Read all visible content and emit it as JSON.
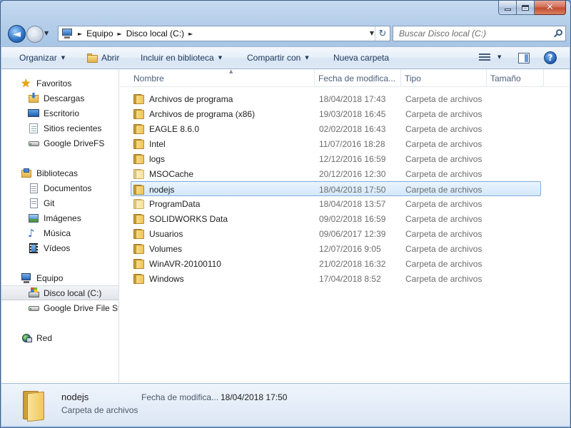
{
  "window": {
    "minimize_glyph": "",
    "close_glyph": "✕"
  },
  "navigation": {
    "back_arrow": "◄",
    "forward_arrow": "►",
    "history_caret": "▼",
    "address": {
      "breadcrumbs": [
        "Equipo",
        "Disco local (C:)"
      ],
      "separator": "►",
      "dropdown_caret": "▼",
      "refresh_glyph": "↻"
    },
    "search": {
      "placeholder": "Buscar Disco local (C:)"
    }
  },
  "toolbar": {
    "organize": "Organizar",
    "open": "Abrir",
    "include_in_library": "Incluir en biblioteca",
    "share_with": "Compartir con",
    "new_folder": "Nueva carpeta",
    "caret": "▼",
    "help": "?"
  },
  "sidebar": {
    "favorites": {
      "label": "Favoritos",
      "items": [
        "Descargas",
        "Escritorio",
        "Sitios recientes",
        "Google DriveFS"
      ]
    },
    "libraries": {
      "label": "Bibliotecas",
      "items": [
        "Documentos",
        "Git",
        "Imágenes",
        "Música",
        "Vídeos"
      ]
    },
    "computer": {
      "label": "Equipo",
      "items": [
        "Disco local (C:)",
        "Google Drive File Str"
      ],
      "selected": "Disco local (C:)"
    },
    "network": {
      "label": "Red"
    },
    "icons": {
      "star": "★",
      "music": "♪"
    }
  },
  "file_list": {
    "columns": {
      "name": "Nombre",
      "date": "Fecha de modifica...",
      "type": "Tipo",
      "size": "Tamaño",
      "sort_caret": "▲"
    },
    "rows": [
      {
        "name": "Archivos de programa",
        "date": "18/04/2018 17:43",
        "type": "Carpeta de archivos"
      },
      {
        "name": "Archivos de programa (x86)",
        "date": "19/03/2018 16:45",
        "type": "Carpeta de archivos"
      },
      {
        "name": "EAGLE 8.6.0",
        "date": "02/02/2018 16:43",
        "type": "Carpeta de archivos"
      },
      {
        "name": "Intel",
        "date": "11/07/2016 18:28",
        "type": "Carpeta de archivos"
      },
      {
        "name": "logs",
        "date": "12/12/2016 16:59",
        "type": "Carpeta de archivos"
      },
      {
        "name": "MSOCache",
        "date": "20/12/2016 12:30",
        "type": "Carpeta de archivos"
      },
      {
        "name": "nodejs",
        "date": "18/04/2018 17:50",
        "type": "Carpeta de archivos"
      },
      {
        "name": "ProgramData",
        "date": "18/04/2018 13:57",
        "type": "Carpeta de archivos"
      },
      {
        "name": "SOLIDWORKS Data",
        "date": "09/02/2018 16:59",
        "type": "Carpeta de archivos"
      },
      {
        "name": "Usuarios",
        "date": "09/06/2017 12:39",
        "type": "Carpeta de archivos"
      },
      {
        "name": "Volumes",
        "date": "12/07/2016 9:05",
        "type": "Carpeta de archivos"
      },
      {
        "name": "WinAVR-20100110",
        "date": "21/02/2018 16:32",
        "type": "Carpeta de archivos"
      },
      {
        "name": "Windows",
        "date": "17/04/2018 8:52",
        "type": "Carpeta de archivos"
      }
    ],
    "selected": "nodejs"
  },
  "details_pane": {
    "name": "nodejs",
    "type": "Carpeta de archivos",
    "date_label": "Fecha de modifica...",
    "date_value": "18/04/2018 17:50"
  }
}
